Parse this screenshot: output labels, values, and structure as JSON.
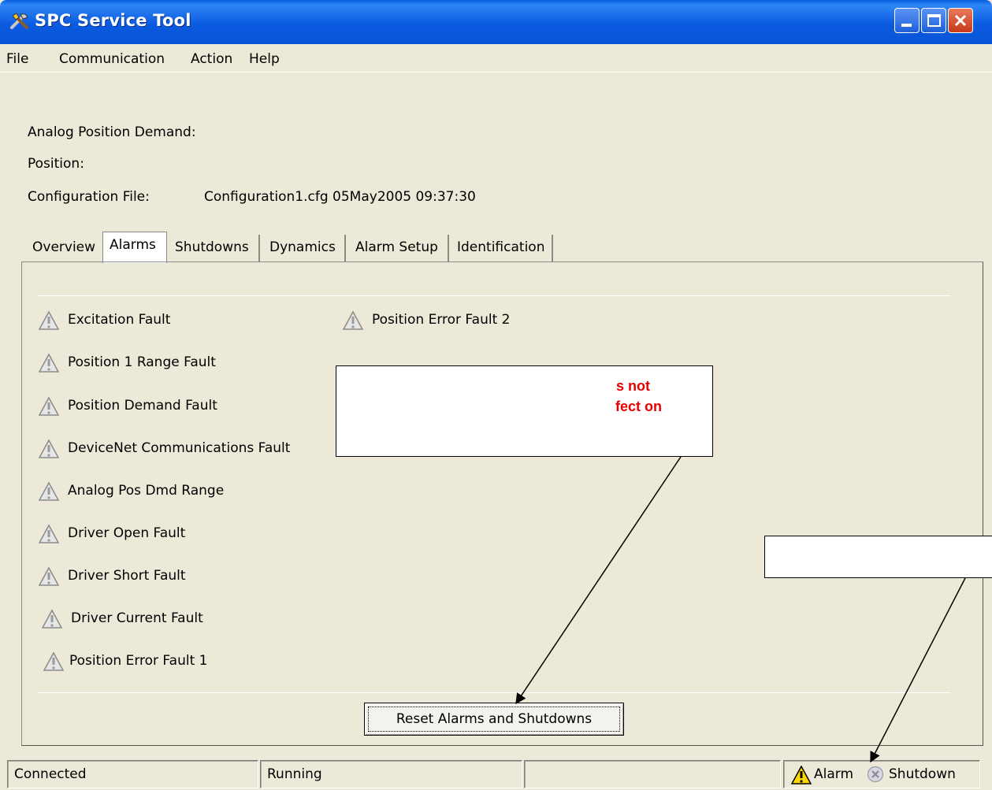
{
  "window": {
    "title": "SPC Service Tool"
  },
  "menu": [
    "File",
    "Communication",
    "Action",
    "Help"
  ],
  "info": {
    "analog_label": "Analog Position Demand:",
    "position_label": "Position:",
    "config_label": "Configuration File:",
    "config_value": "Configuration1.cfg 05May2005 09:37:30"
  },
  "tabs": [
    "Overview",
    "Alarms",
    "Shutdowns",
    "Dynamics",
    "Alarm Setup",
    "Identification"
  ],
  "active_tab": "Alarms",
  "alarms_left": [
    "Excitation Fault",
    "Position 1 Range Fault",
    "Position Demand Fault",
    "DeviceNet Communications Fault",
    "Analog Pos Dmd Range",
    "Driver Open Fault",
    "Driver Short Fault",
    "Driver Current Fault",
    "Position Error Fault 1"
  ],
  "alarms_right": [
    "Position Error Fault 2"
  ],
  "reset_button": "Reset Alarms and Shutdowns",
  "status": {
    "connection": "Connected",
    "state": "Running",
    "empty": "",
    "alarm": "Alarm",
    "shutdown": "Shutdown"
  },
  "callouts": {
    "main_line1": "s not",
    "main_line2": "fect on"
  },
  "colors": {
    "titlebar": "#0a5fe0",
    "window_bg": "#ece9d8",
    "callout_text": "#e60000"
  }
}
